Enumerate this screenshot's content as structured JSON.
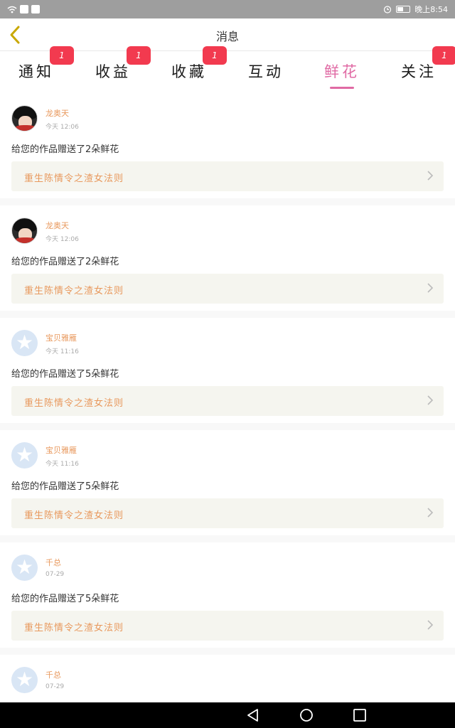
{
  "status_bar": {
    "time": "晚上8:54",
    "icons": [
      "wifi-icon",
      "app-icon",
      "app-icon",
      "alarm-icon",
      "battery-icon"
    ]
  },
  "header": {
    "title": "消息",
    "back_icon": "chevron-left-icon",
    "accent_color": "#c9a800"
  },
  "tabs": [
    {
      "label": "通知",
      "badge": "1"
    },
    {
      "label": "收益",
      "badge": "1"
    },
    {
      "label": "收藏",
      "badge": "1"
    },
    {
      "label": "互动",
      "badge": ""
    },
    {
      "label": "鲜花",
      "badge": "",
      "active": true
    },
    {
      "label": "关注",
      "badge": "1"
    }
  ],
  "colors": {
    "active_tab": "#e06aa4",
    "badge": "#f23a4f",
    "username": "#e8985c",
    "book_title": "#e8985c"
  },
  "feed": [
    {
      "username": "龙奥天",
      "time": "今天 12:06",
      "message": "给您的作品赠送了2朵鲜花",
      "book": "重生陈情令之渣女法则",
      "avatar": "photo"
    },
    {
      "username": "龙奥天",
      "time": "今天 12:06",
      "message": "给您的作品赠送了2朵鲜花",
      "book": "重生陈情令之渣女法则",
      "avatar": "photo"
    },
    {
      "username": "宝贝雅雁",
      "time": "今天 11:16",
      "message": "给您的作品赠送了5朵鲜花",
      "book": "重生陈情令之渣女法则",
      "avatar": "default"
    },
    {
      "username": "宝贝雅雁",
      "time": "今天 11:16",
      "message": "给您的作品赠送了5朵鲜花",
      "book": "重生陈情令之渣女法则",
      "avatar": "default"
    },
    {
      "username": "千总",
      "time": "07-29",
      "message": "给您的作品赠送了5朵鲜花",
      "book": "重生陈情令之渣女法则",
      "avatar": "default"
    },
    {
      "username": "千总",
      "time": "07-29",
      "message": "",
      "book": "",
      "avatar": "default"
    }
  ],
  "nav_bar": {
    "buttons": [
      "back-triangle-icon",
      "home-circle-icon",
      "recents-square-icon"
    ]
  }
}
